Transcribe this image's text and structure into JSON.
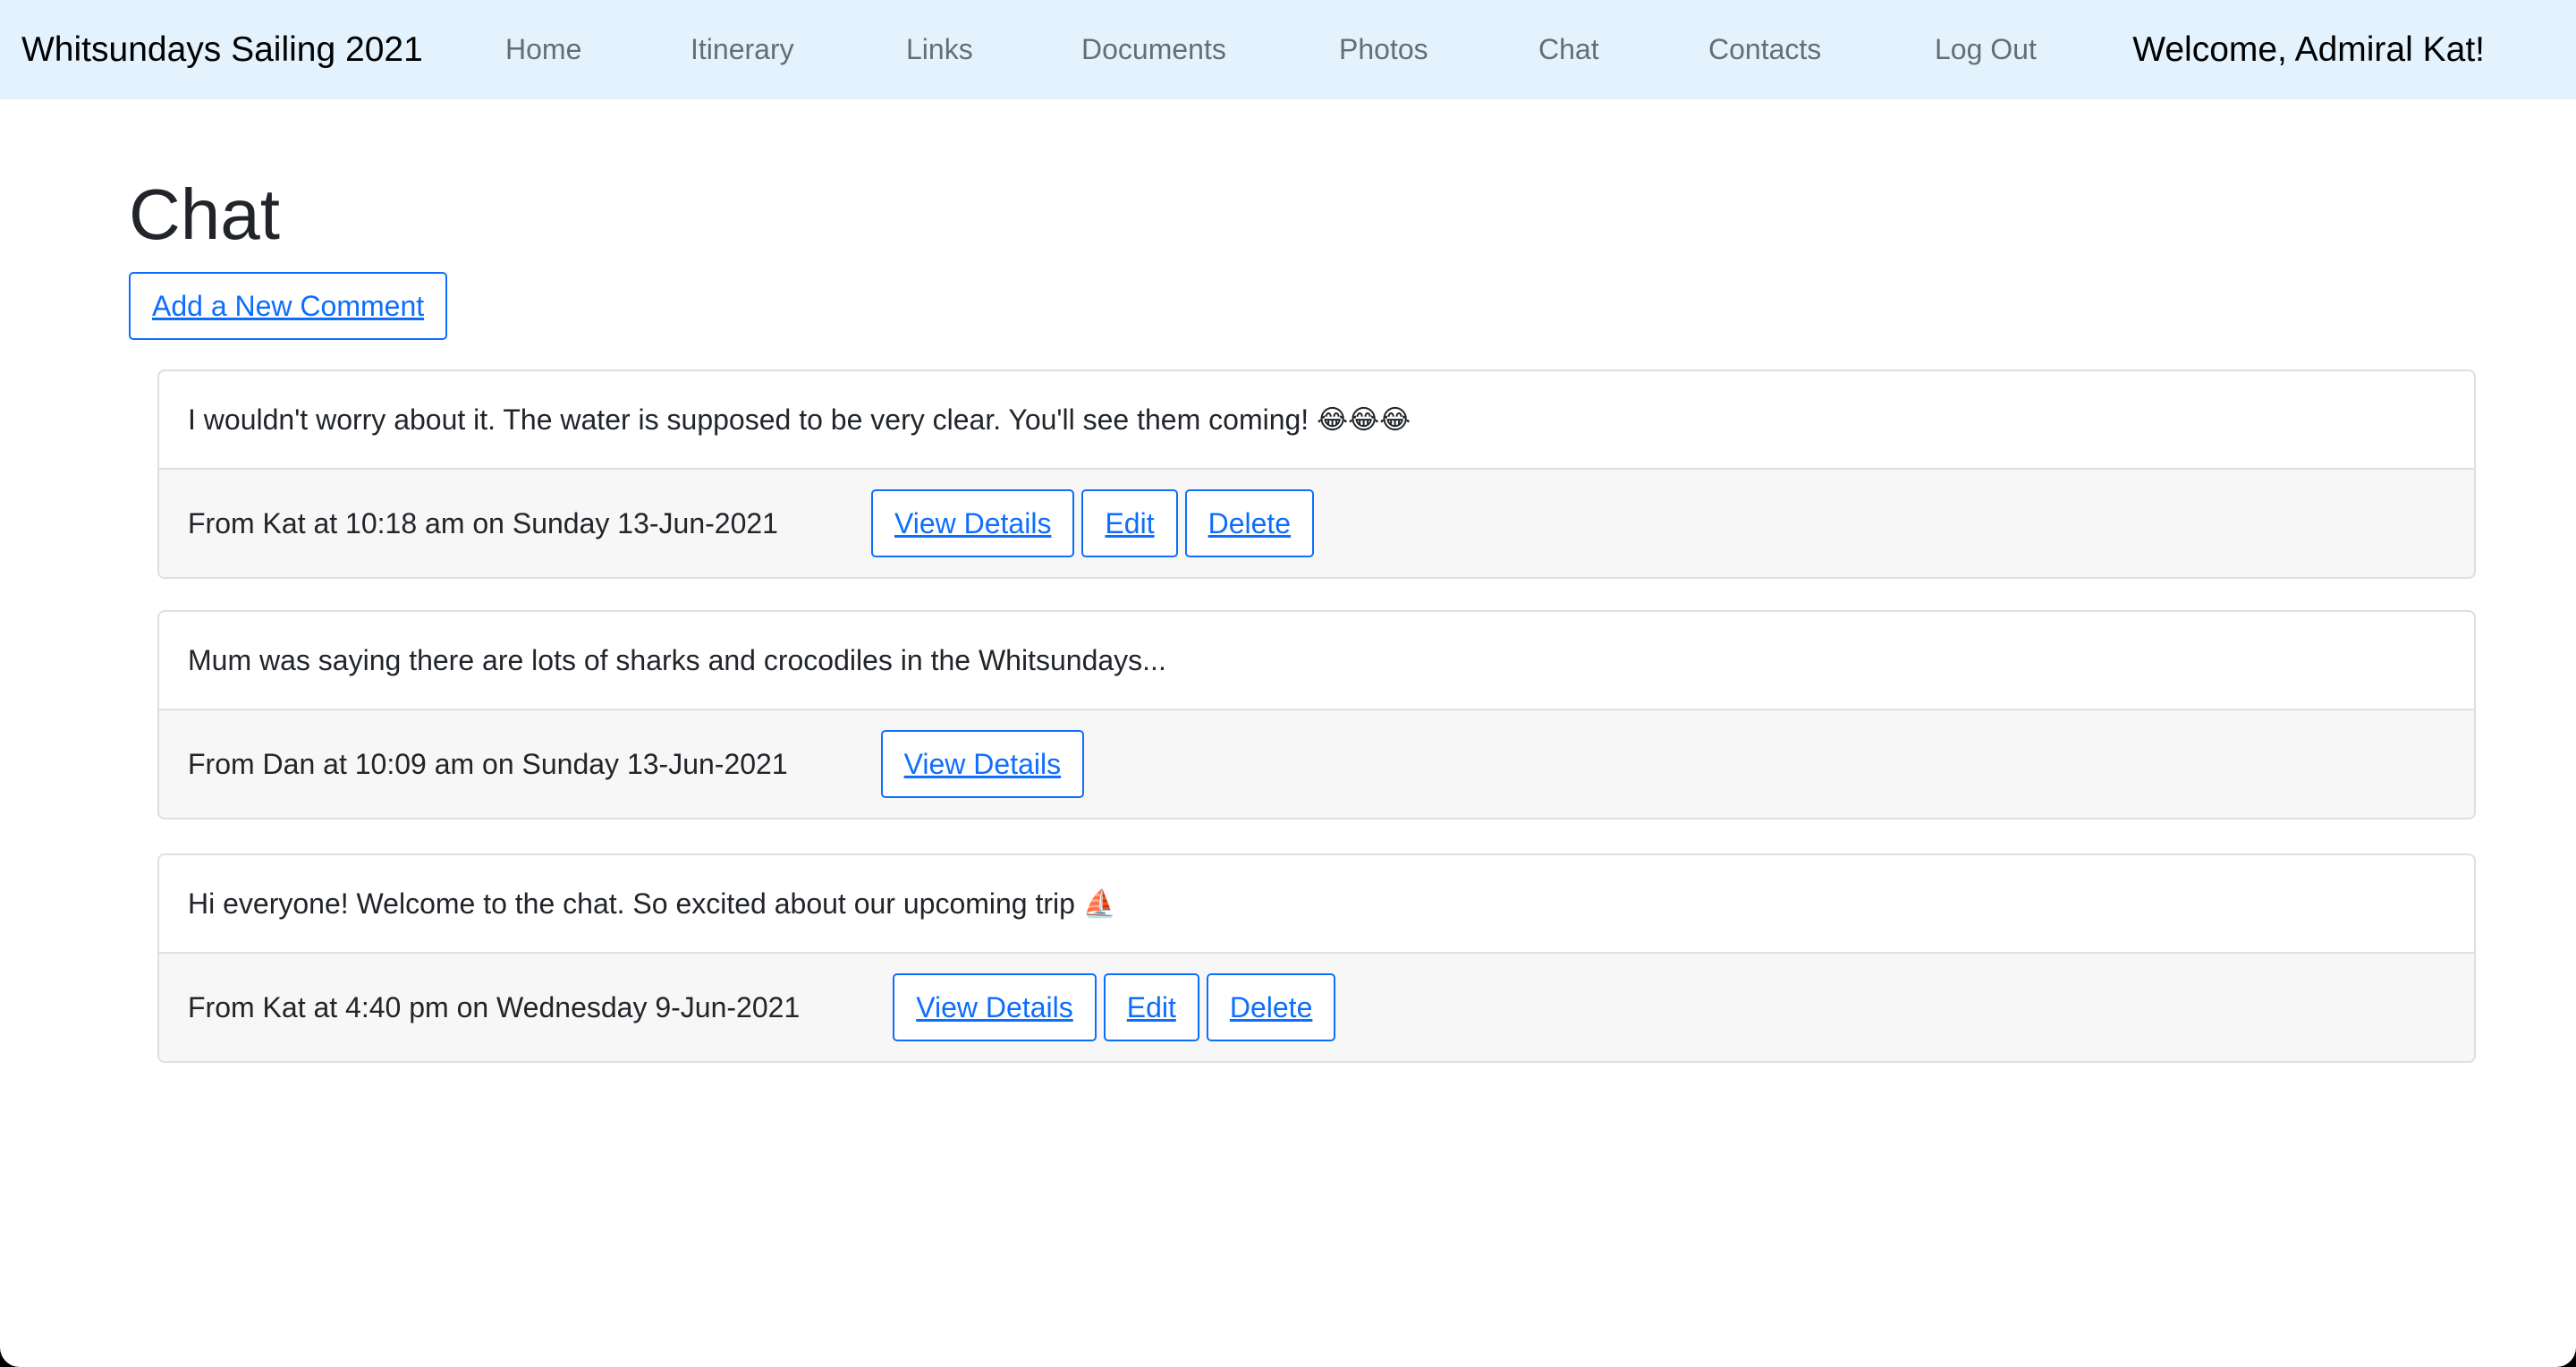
{
  "nav": {
    "brand": "Whitsundays Sailing 2021",
    "links": [
      "Home",
      "Itinerary",
      "Links",
      "Documents",
      "Photos",
      "Chat",
      "Contacts",
      "Log Out"
    ],
    "welcome": "Welcome, Admiral Kat!"
  },
  "main": {
    "title": "Chat",
    "add_comment_label": "Add a New Comment"
  },
  "comments": [
    {
      "text": "I wouldn't worry about it. The water is supposed to be very clear. You'll see them coming!",
      "emoji": "😂😂😂",
      "meta": "From Kat at 10:18 am on Sunday 13-Jun-2021",
      "actions": [
        "View Details",
        "Edit",
        "Delete"
      ]
    },
    {
      "text": "Mum was saying there are lots of sharks and crocodiles in the Whitsundays...",
      "emoji": "",
      "meta": "From Dan at 10:09 am on Sunday 13-Jun-2021",
      "actions": [
        "View Details"
      ]
    },
    {
      "text": "Hi everyone! Welcome to the chat. So excited about our upcoming trip",
      "emoji": "⛵",
      "meta": "From Kat at 4:40 pm on Wednesday 9-Jun-2021",
      "actions": [
        "View Details",
        "Edit",
        "Delete"
      ]
    }
  ],
  "colors": {
    "navbar_bg": "#e3f2fd",
    "accent": "#0d6efd",
    "footer_bg": "#f7f7f7"
  }
}
